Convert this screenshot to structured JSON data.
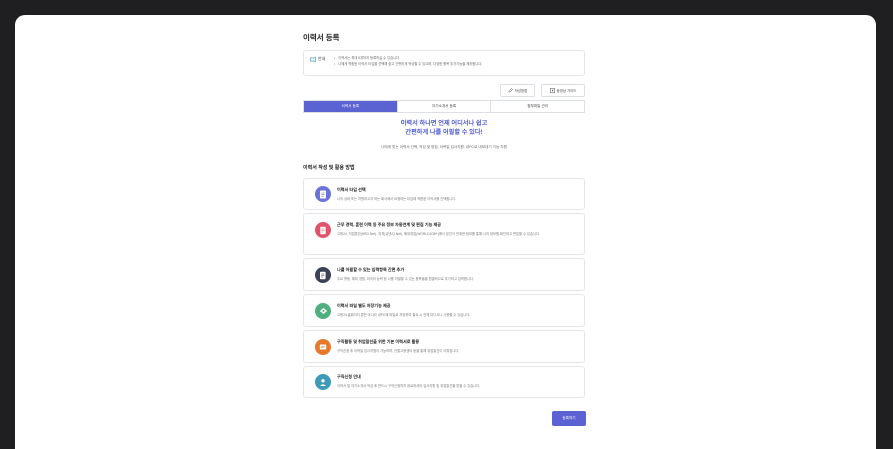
{
  "page": {
    "title": "이력서 등록"
  },
  "notice": {
    "label": "안내",
    "lines": [
      "이력서는 최대 5개까지 등록하실 수 있습니다.",
      "나에게 적합한 이력서 타입을 선택해 쉽고 간편하게 작성할 수 있으며, 다양한 항목 추가기능을 제공합니다."
    ]
  },
  "tools": {
    "usage_label": "작성방법",
    "video_label": "동영상 가이드"
  },
  "tabs": [
    {
      "label": "이력서 등록",
      "active": true
    },
    {
      "label": "자기소개서 등록",
      "active": false
    },
    {
      "label": "첨부파일 관리",
      "active": false
    }
  ],
  "hero": {
    "line1": "이력서 하나면 언제 어디서나 쉽고",
    "line2": "간편하게 나를 어필할 수 있다!",
    "sub": "나에게 맞는 이력서 선택, 작성 및 편집, 이력일 입사지원, 내PC로 내보내기 기능 지원"
  },
  "section": {
    "title": "이력서 작성 및 활용 방법"
  },
  "cards": [
    {
      "title": "이력서 타입 선택",
      "desc": "나의 상태 또는 지원하고자 하는 회사에서 요청하는 타입에 적합한 이력서를 선택합니다.",
      "icon": "document-select-icon",
      "color": "#6b73d8"
    },
    {
      "title": "근무 경력, 훈련 이력 등 주요 정보 자동연계 및 편집 기능 제공",
      "desc": "고용24, 직업훈련(HRD-Net), 자격(큐넷/Q-Net), 해외취업(WORLDJOB+)에서 본인이 연계한 정보를 통해 나의 정보를 확인하고 편집할 수 있습니다.",
      "icon": "sync-icon",
      "color": "#e0536b"
    },
    {
      "title": "나를 어필할 수 있는 입력항목 간편 추가",
      "desc": "주요 활동, 해외 경험, 외국어 능력 등 나를 어필할 수 있는 항목들을 원클릭으로 추가하고 입력합니다.",
      "icon": "edit-document-icon",
      "color": "#3c4256"
    },
    {
      "title": "이력서 파일 별도 저장기능 제공",
      "desc": "고용24 홈페이지 뿐만 아니라 내PC에 파일로 저장하여 필요 시 언제 어디서나 사용할 수 있습니다.",
      "icon": "save-file-icon",
      "color": "#4faf7e"
    },
    {
      "title": "구직활동 및 취업알선을 위한 기본 이력서로 활용",
      "desc": "구직신청 후 이력일 입사지원이 가능하며, 관할고용센터 등을 통해 취업알선이 이뤄집니다.",
      "icon": "job-support-icon",
      "color": "#e5792c"
    },
    {
      "title": "구직신청 안내",
      "desc": "이력서 및 자기소개서 작성 후 반드시 구직신청까지 완료하셔야 입사지원 및 취업알선을 받을 수 있습니다.",
      "icon": "user-guide-icon",
      "color": "#3d9bb8"
    }
  ],
  "submit_label": "등록하기"
}
